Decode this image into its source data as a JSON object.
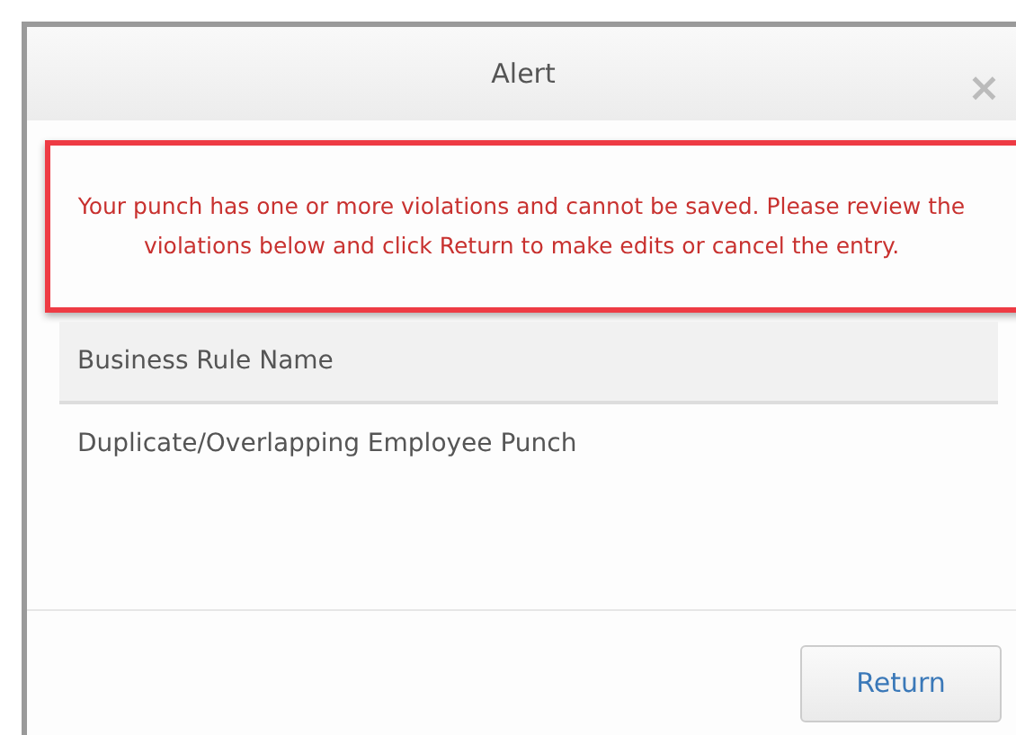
{
  "dialog": {
    "title": "Alert",
    "close": "×"
  },
  "message": "Your punch has one or more violations and cannot be saved. Please review the violations below and click Return to make edits or cancel the entry.",
  "table": {
    "columns": [
      "Business Rule Name"
    ],
    "rows": [
      [
        "Duplicate/Overlapping Employee Punch"
      ]
    ]
  },
  "buttons": [
    "Return"
  ]
}
